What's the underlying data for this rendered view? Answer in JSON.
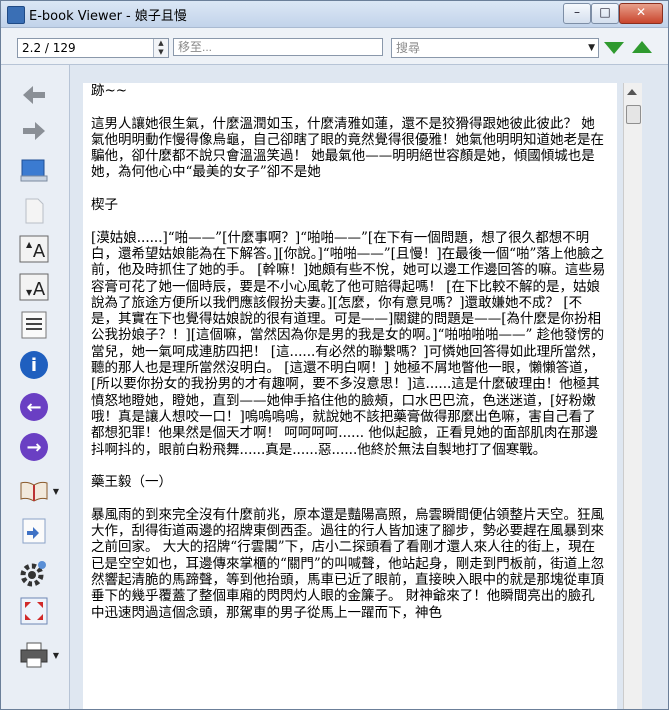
{
  "window": {
    "title": "E-book Viewer - 娘子且慢"
  },
  "titlebar_controls": {
    "minimize": "–",
    "maximize": "□",
    "close": "✕"
  },
  "toolbar": {
    "position_value": "2.2 / 129",
    "goto_placeholder": "移至...",
    "search_placeholder": "搜尋",
    "colors": {
      "nav_arrow": "#2f9a2f"
    }
  },
  "sidebar": {
    "items": [
      {
        "name": "back",
        "icon": "arrow-left-icon"
      },
      {
        "name": "forward",
        "icon": "arrow-right-icon"
      },
      {
        "name": "library",
        "icon": "library-icon"
      },
      {
        "name": "copy",
        "icon": "copy-icon"
      },
      {
        "name": "font-larger",
        "icon": "font-larger-icon",
        "glyph": "A"
      },
      {
        "name": "font-smaller",
        "icon": "font-smaller-icon",
        "glyph": "A"
      },
      {
        "name": "toc",
        "icon": "toc-icon"
      },
      {
        "name": "info",
        "icon": "info-icon",
        "glyph": "i"
      },
      {
        "name": "previous",
        "icon": "previous-icon"
      },
      {
        "name": "next",
        "icon": "next-icon"
      },
      {
        "name": "open-book",
        "icon": "open-book-icon"
      },
      {
        "name": "bookmark",
        "icon": "bookmark-icon"
      },
      {
        "name": "preferences",
        "icon": "gear-icon"
      },
      {
        "name": "fullscreen",
        "icon": "fullscreen-icon"
      },
      {
        "name": "print",
        "icon": "print-icon"
      }
    ]
  },
  "content": {
    "paragraphs": [
      "跡~~",
      "這男人讓她很生氣，什麼溫潤如玉，什麼清雅如蓮，還不是狡猾得跟她彼此彼此？ 她氣他明明動作慢得像烏龜，自己卻瞎了眼的竟然覺得很優雅！她氣他明明知道她老是在騙他，卻什麼都不說只會溫溫笑過！ 她最氣他——明明絕世容顏是她，傾國傾城也是她，為何他心中“最美的女子”卻不是她",
      "楔子",
      "[漠姑娘......]“啪——”[什麼事啊？]“啪啪——”[在下有一個問題，想了很久都想不明白，還希望姑娘能為在下解答。][你說。]“啪啪——”[且慢！]在最後一個“啪”落上他臉之前，他及時抓住了她的手。 [幹嘛！]她頗有些不悅，她可以邊工作邊回答的嘛。這些易容膏可花了她一個時辰，要是不小心風乾了他可賠得起嗎！ [在下比較不解的是，姑娘說為了旅途方便所以我們應該假扮夫妻。][怎麼，你有意見嗎？]還敢嫌她不成？ [不是，其實在下也覺得姑娘說的很有道理。可是——]關鍵的問題是——[為什麼是你扮相公我扮娘子？！][這個嘛，當然因為你是男的我是女的啊。]“啪啪啪啪——” 趁他發愣的當兒，她一氣呵成連肪四把！ [這......有必然的聯繫嗎？]可憐她回答得如此理所當然，聽的那人也是理所當然沒明白。 [這還不明白啊！] 她極不屑地瞥他一眼，懶懶答道，[所以要你扮女的我扮男的才有趣啊，要不多沒意思！]這......這是什麼破理由！他極其憤怒地瞪她，瞪她，直到——她伸手掐住他的臉頰，口水巴巴流，色迷迷道，[好粉嫩哦！真是讓人想咬一口！]嗚嗚嗚嗚，就說她不該把藥膏做得那麼出色嘛，害自己看了都想犯罪！他果然是個天才啊！ 呵呵呵呵...... 他似起臉，正看見她的面部肌肉在那邊抖啊抖的，眼前白粉飛舞......真是......惡......他終於無法自製地打了個寒戰。",
      "藥王毅（一）",
      "暴風雨的到來完全沒有什麼前兆，原本還是豔陽高照，烏雲瞬間便佔領整片天空。狂風大作，刮得街道兩邊的招牌東倒西歪。過往的行人皆加速了腳步，勢必要趕在風暴到來之前回家。 大大的招牌“行雲閣”下，店小二探頭看了看剛才還人來人往的街上，現在已是空空如也，耳邊傳來掌櫃的“關門”的叫喊聲，他站起身，剛走到門板前，街道上忽然響起清脆的馬蹄聲，等到他抬頭，馬車已近了眼前，直接映入眼中的就是那塊從車頂垂下的幾乎覆蓋了整個車廂的閃閃灼人眼的金簾子。 財神爺來了！他瞬間亮出的臉孔中迅速閃過這個念頭，那駕車的男子從馬上一躍而下，神色"
    ]
  }
}
